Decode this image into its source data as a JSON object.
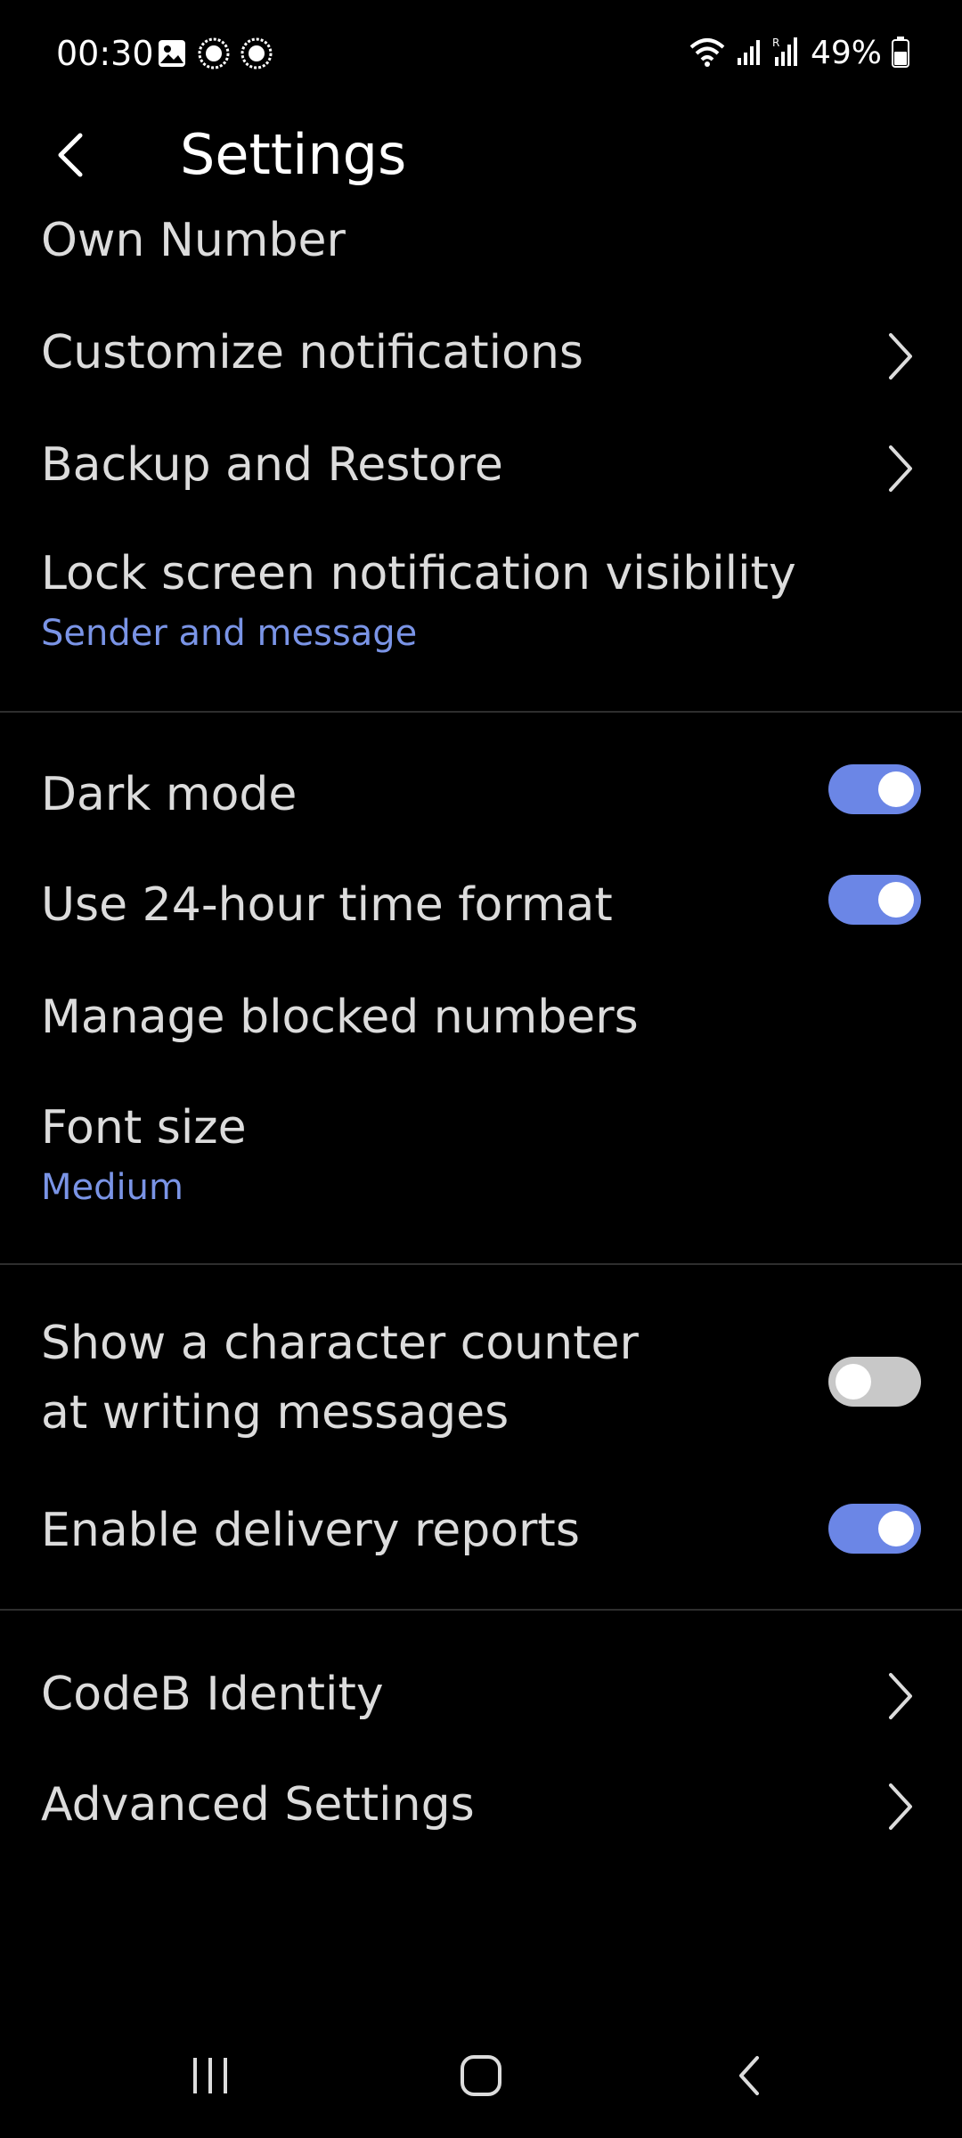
{
  "status_bar": {
    "time": "00:30",
    "battery": "49%",
    "icons_left": [
      "image-icon",
      "app-badge-icon",
      "app-badge-icon"
    ],
    "icons_right": [
      "wifi-icon",
      "signal-icon",
      "signal-roaming-icon",
      "battery-icon"
    ]
  },
  "app_bar": {
    "title": "Settings",
    "back_icon": "chevron-left-icon"
  },
  "settings": {
    "own_number": "Own Number",
    "customize_notifications": "Customize notifications",
    "backup_restore": "Backup and Restore",
    "lock_screen": {
      "title": "Lock screen notification visibility",
      "value": "Sender and message"
    },
    "dark_mode": {
      "title": "Dark mode",
      "enabled": true
    },
    "time_format": {
      "title": "Use 24-hour time format",
      "enabled": true
    },
    "blocked_numbers": "Manage blocked numbers",
    "font_size": {
      "title": "Font size",
      "value": "Medium"
    },
    "char_counter": {
      "line1": "Show a character counter",
      "line2": "at writing messages",
      "enabled": false
    },
    "delivery_reports": {
      "title": "Enable delivery reports",
      "enabled": true
    },
    "codeb_identity": "CodeB Identity",
    "advanced_settings": "Advanced Settings"
  },
  "nav_bar": {
    "recents_icon": "recent-apps-icon",
    "home_icon": "home-icon",
    "back_icon": "back-icon"
  },
  "colors": {
    "accent": "#6b86e6",
    "subtitle": "#7a94e6",
    "background": "#000000",
    "toggle_off": "#c8c8c8"
  }
}
